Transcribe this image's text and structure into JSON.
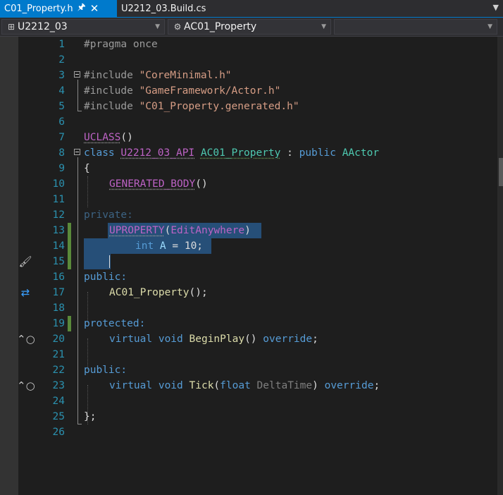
{
  "tabs": [
    {
      "label": "C01_Property.h",
      "active": true
    },
    {
      "label": "U2212_03.Build.cs",
      "active": false
    }
  ],
  "nav": {
    "project": "U2212_03",
    "scope": "AC01_Property",
    "member": ""
  },
  "icons": {
    "pin": "pin-icon",
    "close": "close-icon",
    "overflow": "chevron-down-icon",
    "project": "cpp-project-icon",
    "scope": "class-icon",
    "brush": "brush-icon",
    "swap": "swap-arrows-icon",
    "override": "override-icon"
  },
  "editor": {
    "line_numbers": [
      "1",
      "2",
      "3",
      "4",
      "5",
      "6",
      "7",
      "8",
      "9",
      "10",
      "11",
      "12",
      "13",
      "14",
      "15",
      "16",
      "17",
      "18",
      "19",
      "20",
      "21",
      "22",
      "23",
      "24",
      "25",
      "26"
    ],
    "code": {
      "l1": "#pragma once",
      "l3_a": "#include ",
      "l3_b": "\"CoreMinimal.h\"",
      "l4_a": "#include ",
      "l4_b": "\"GameFramework/Actor.h\"",
      "l5_a": "#include ",
      "l5_b": "\"C01_Property.generated.h\"",
      "l7_a": "UCLASS",
      "l7_b": "()",
      "l8_a": "class ",
      "l8_b": "U2212_03_API",
      "l8_c": " ",
      "l8_d": "AC01_Property",
      "l8_e": " : ",
      "l8_f": "public ",
      "l8_g": "AActor",
      "l9": "{",
      "l10_a": "GENERATED_BODY",
      "l10_b": "()",
      "l12": "private:",
      "l13_a": "UPROPERTY",
      "l13_b": "(",
      "l13_c": "EditAnywhere",
      "l13_d": ")",
      "l14_a": "int ",
      "l14_b": "A",
      "l14_c": " = 10;",
      "l16": "public:",
      "l17_a": "AC01_Property",
      "l17_b": "();",
      "l19": "protected:",
      "l20_a": "virtual void ",
      "l20_b": "BeginPlay",
      "l20_c": "() ",
      "l20_d": "override",
      "l20_e": ";",
      "l22": "public:",
      "l23_a": "virtual void ",
      "l23_b": "Tick",
      "l23_c": "(",
      "l23_d": "float ",
      "l23_e": "DeltaTime",
      "l23_f": ") ",
      "l23_g": "override",
      "l23_h": ";",
      "l25": "};"
    }
  },
  "colors": {
    "accent": "#007acc",
    "line_number": "#2b91af",
    "keyword": "#569cd6",
    "macro": "#bd63c5",
    "string": "#d69d85",
    "type": "#4ec9b0",
    "function": "#dcdcaa",
    "selection": "#264f78",
    "change_marker": "#5a8a3a"
  }
}
